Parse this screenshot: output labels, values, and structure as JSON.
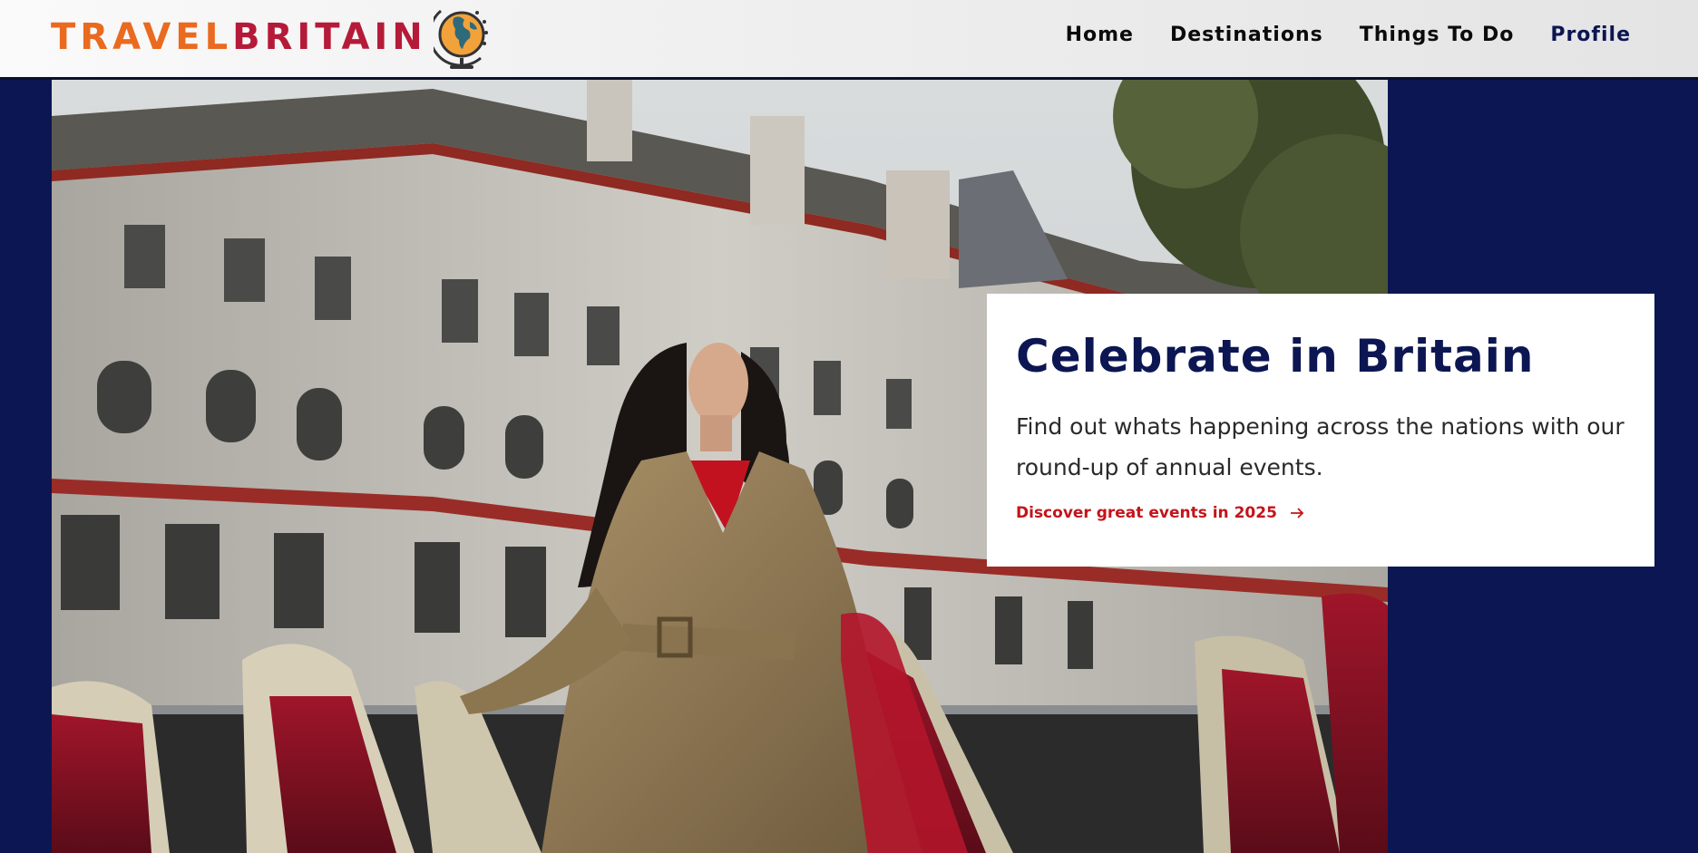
{
  "header": {
    "brand_part1": "TRAVEL",
    "brand_part2": "BRITAIN",
    "logo_icon": "globe-icon",
    "nav": [
      {
        "label": "Home"
      },
      {
        "label": "Destinations"
      },
      {
        "label": "Things To Do"
      },
      {
        "label": "Profile",
        "active": true
      }
    ]
  },
  "hero": {
    "image_alt": "Woman in trench coat on open-top tour bus in front of historic building"
  },
  "feature": {
    "title": "Celebrate in Britain",
    "description": "Find out whats happening across the nations with our round-up of annual events.",
    "cta_label": "Discover great events in 2025",
    "cta_icon": "arrow-right-icon"
  },
  "colors": {
    "page_background": "#0c1652",
    "brand_orange": "#ea6a1f",
    "brand_red": "#b51a38",
    "title_navy": "#0c1652",
    "cta_red": "#c4141a"
  }
}
